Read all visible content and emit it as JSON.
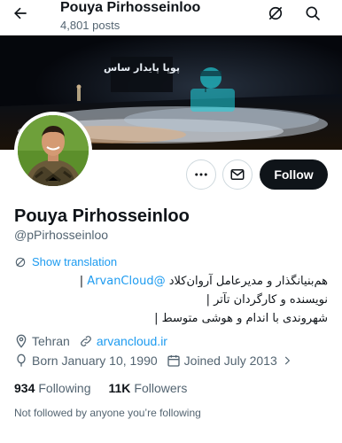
{
  "header": {
    "title": "Pouya Pirhosseinloo",
    "posts_count": "4,801 posts",
    "back_icon": "arrow-left-icon",
    "grok_icon": "grok-icon",
    "search_icon": "search-icon"
  },
  "banner": {
    "screen_text": "پوپا پایدار ساس"
  },
  "profile": {
    "name": "Pouya Pirhosseinloo",
    "handle": "@pPirhosseinloo",
    "follow_label": "Follow",
    "more_icon": "more-options-icon",
    "message_icon": "message-icon"
  },
  "translation": {
    "label": "Show translation"
  },
  "bio": {
    "line1_text": "هم‌بنیانگذار و مدیرعامل آروان‌کلاد ",
    "line1_link": "@ArvanCloud",
    "line1_end": " |",
    "line2": "نویسنده و کارگردان تآتر |",
    "line3": "شهروندی با اندام و هوشی متوسط |"
  },
  "meta": {
    "location": "Tehran",
    "website": "arvancloud.ir",
    "born": "Born January 10, 1990",
    "joined": "Joined July 2013"
  },
  "stats": {
    "following_count": "934",
    "following_label": "Following",
    "followers_count": "11K",
    "followers_label": "Followers"
  },
  "followed_by_text": "Not followed by anyone you’re following",
  "colors": {
    "accent": "#1d9bf0",
    "text": "#0f1419",
    "secondary": "#536471",
    "follow_bg": "#0f1419"
  }
}
